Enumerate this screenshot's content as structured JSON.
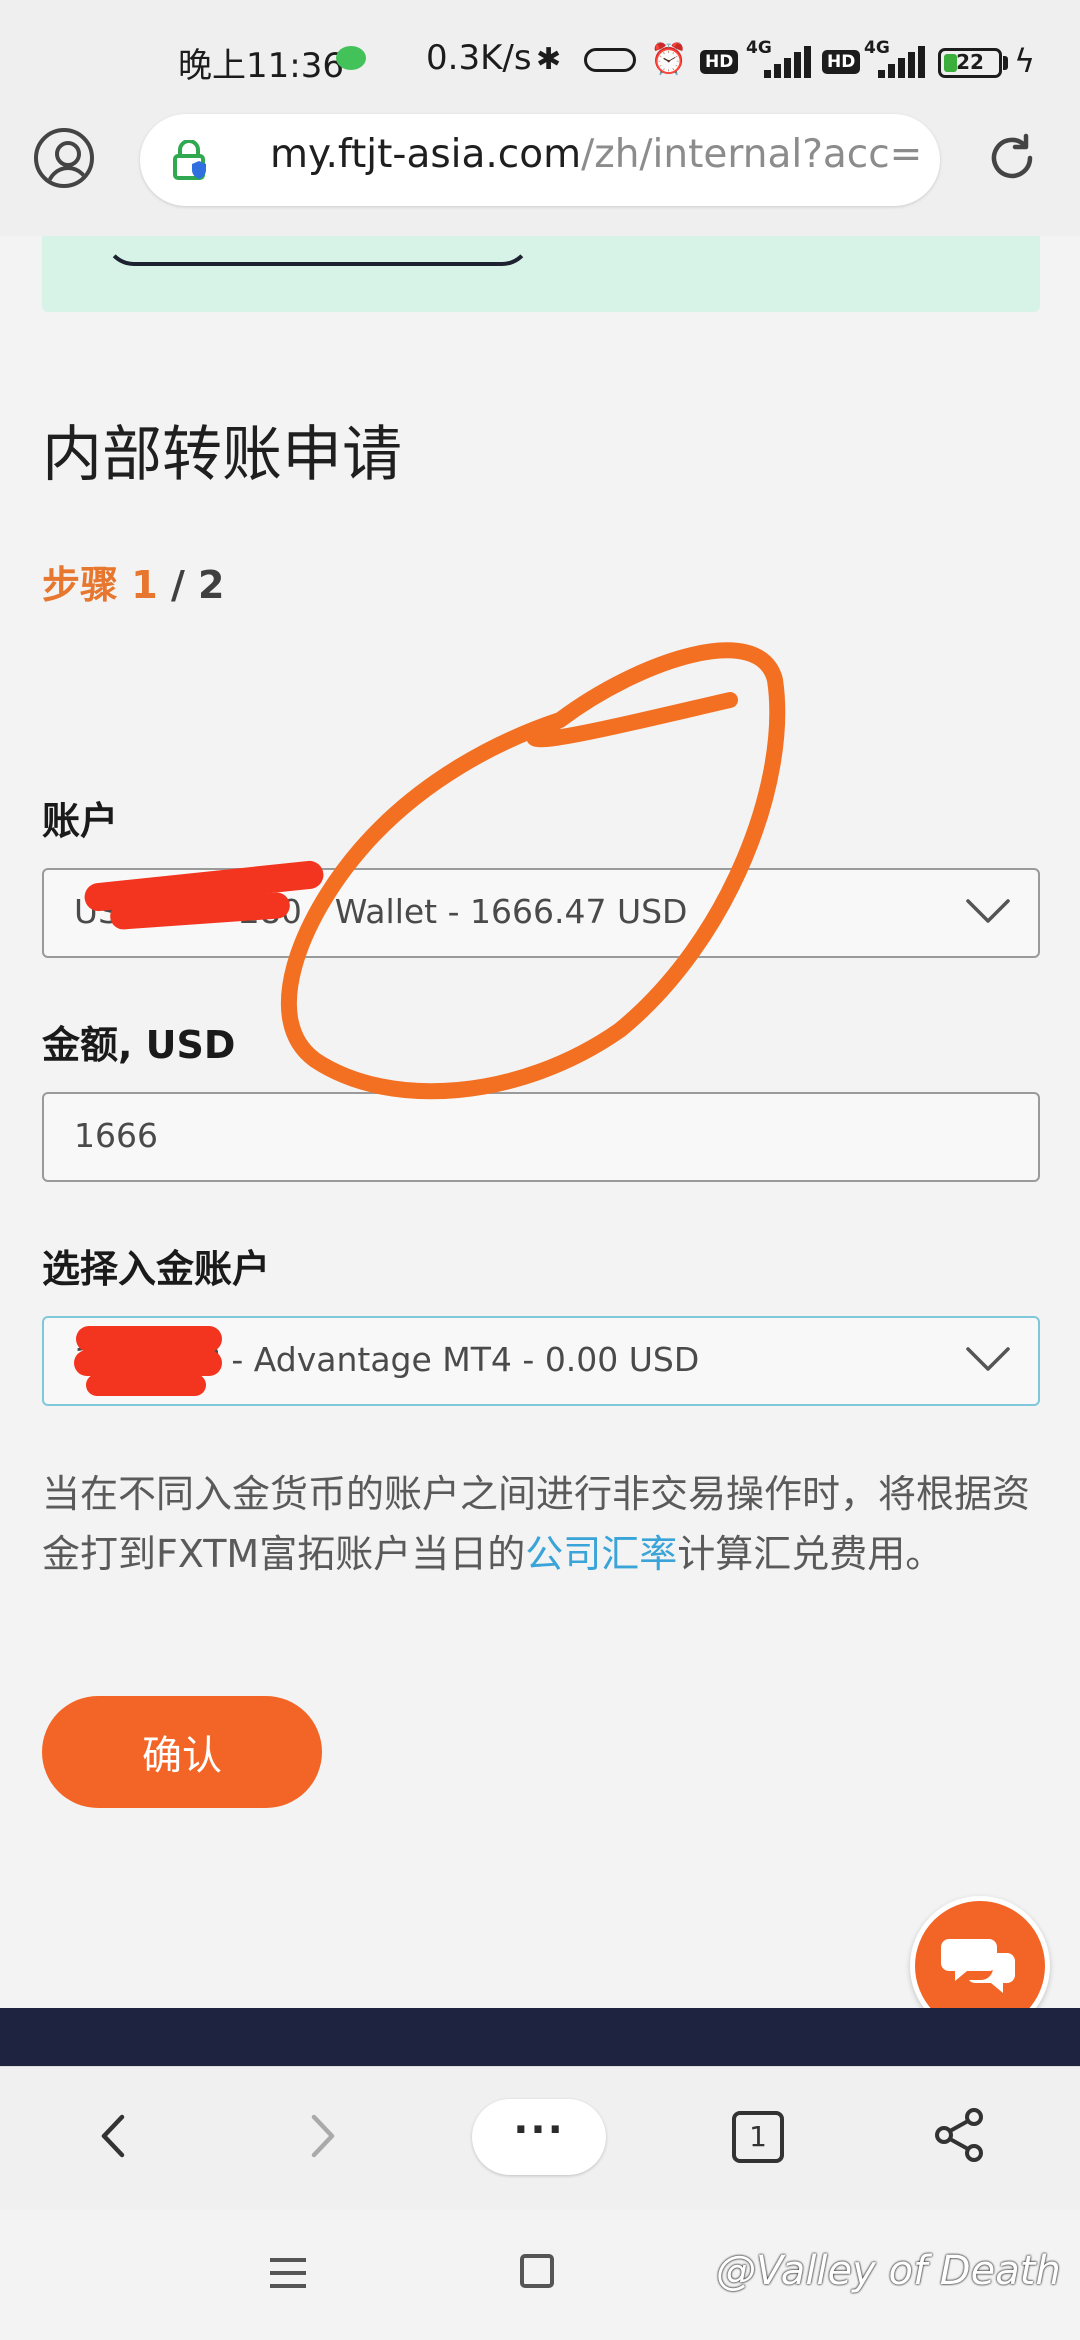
{
  "status_bar": {
    "time": "晚上11:36",
    "net_speed": "0.3K/s",
    "network_1": "4G",
    "network_2": "4G",
    "hd_1": "HD",
    "hd_2": "HD",
    "battery": "22"
  },
  "address_bar": {
    "url_host": "my.ftjt-asia.com",
    "url_path": "/zh/internal?acc="
  },
  "page": {
    "title": "内部转账申请",
    "step_word": "步骤",
    "step_current": "1",
    "step_total": "/ 2"
  },
  "form": {
    "account_label": "账户",
    "account_value": "USD  ·  ·  ·  · 280 - Wallet - 1666.47 USD",
    "amount_label": "金额, USD",
    "amount_value": "1666",
    "target_label": "选择入金账户",
    "target_value": "1  ·  ·  ·  ·58 - Advantage MT4 - 0.00 USD"
  },
  "note": {
    "before": "当在不同入金货币的账户之间进行非交易操作时，将根据资金打到FXTM富拓账户当日的",
    "link": "公司汇率",
    "after": "计算汇兑费用。"
  },
  "confirm_label": "确认",
  "bottom_nav": {
    "more_label": "···",
    "tab_count": "1"
  },
  "watermark": "@Valley of Death",
  "colors": {
    "accent": "#f36526",
    "step": "#e7762f",
    "link": "#3aa4d8",
    "banner": "#d7f3e8",
    "footer": "#1e2340"
  }
}
